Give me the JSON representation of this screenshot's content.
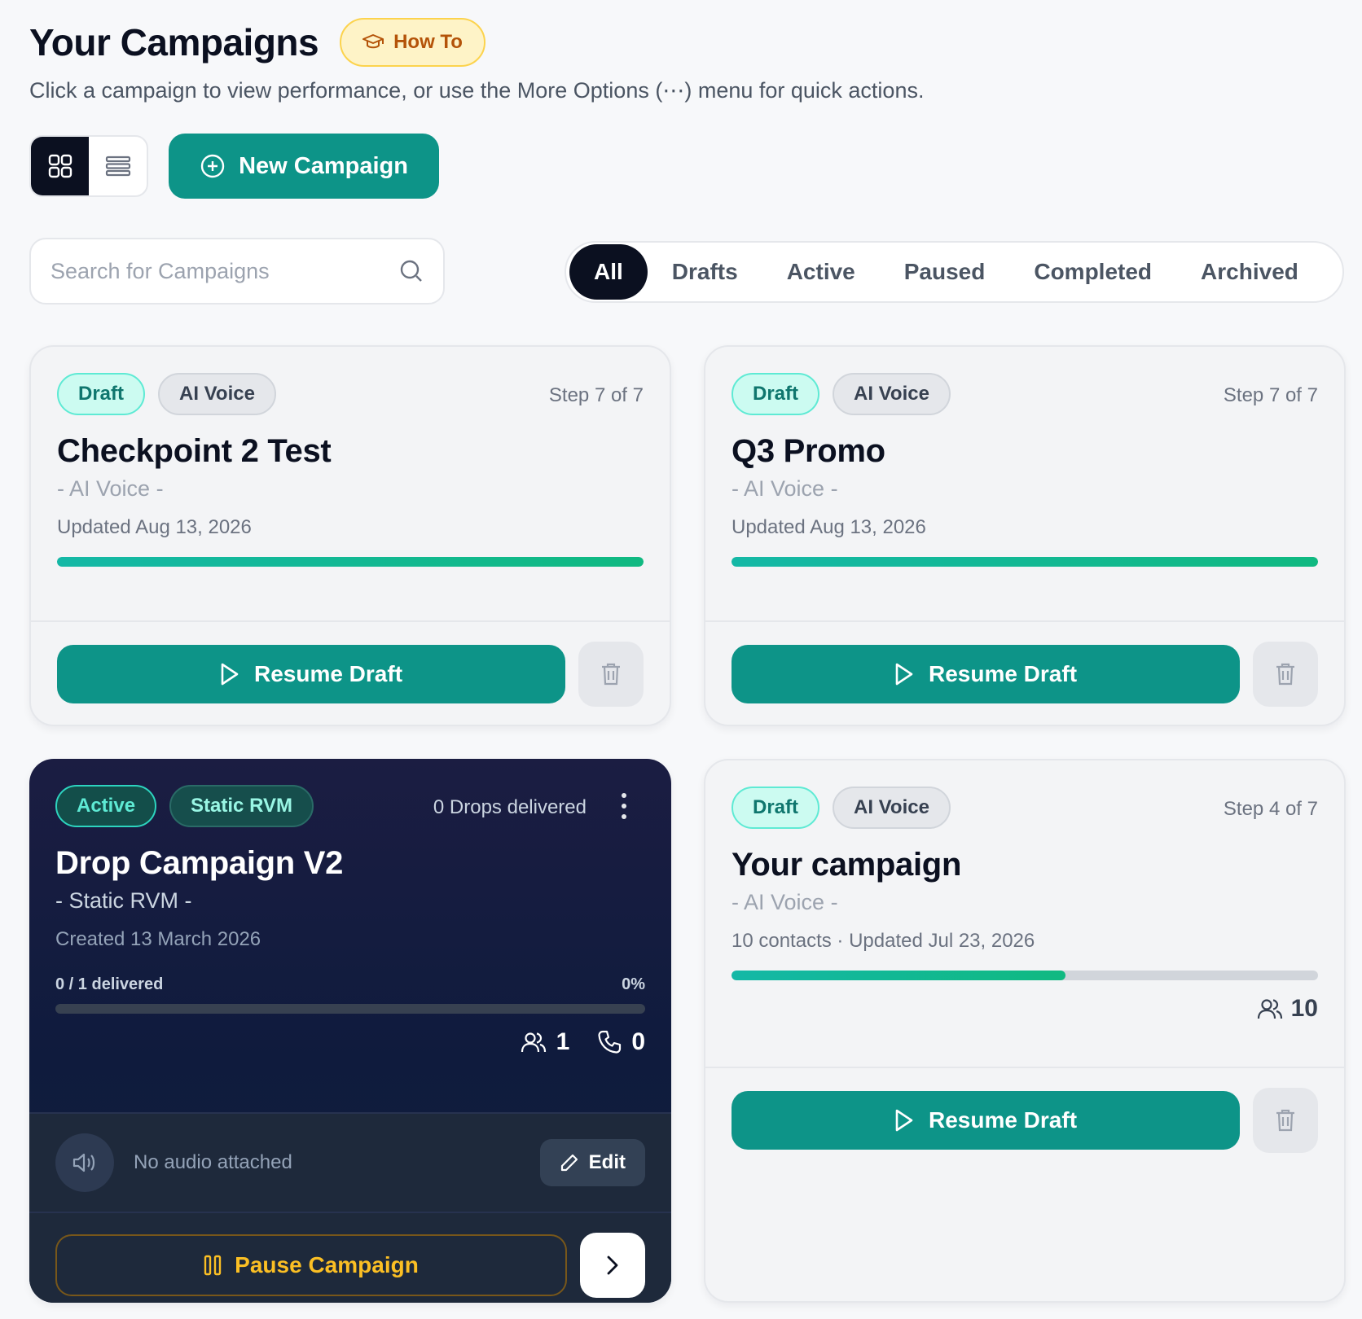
{
  "header": {
    "title": "Your Campaigns",
    "how_to_label": "How To",
    "subtitle": "Click a campaign to view performance, or use the More Options (⋯) menu for quick actions."
  },
  "toolbar": {
    "new_campaign_label": "New Campaign",
    "view_mode": "grid"
  },
  "search": {
    "placeholder": "Search for Campaigns",
    "value": ""
  },
  "filters": {
    "tabs": [
      "All",
      "Drafts",
      "Active",
      "Paused",
      "Completed",
      "Archived"
    ],
    "selected": "All"
  },
  "campaigns": [
    {
      "status": "Draft",
      "type": "AI Voice",
      "step": "Step 7 of 7",
      "name": "Checkpoint 2 Test",
      "subtitle": "- AI Voice -",
      "meta": "Updated Aug 13, 2026",
      "progress": 1.0,
      "action_label": "Resume Draft"
    },
    {
      "status": "Draft",
      "type": "AI Voice",
      "step": "Step 7 of 7",
      "name": "Q3 Promo",
      "subtitle": "- AI Voice -",
      "meta": "Updated Aug 13, 2026",
      "progress": 1.0,
      "action_label": "Resume Draft"
    },
    {
      "status": "Active",
      "type": "Static RVM",
      "drops": "0 Drops delivered",
      "name": "Drop Campaign V2",
      "subtitle": "- Static RVM -",
      "meta": "Created 13 March 2026",
      "delivered_label": "0 / 1 delivered",
      "delivered_pct": "0%",
      "progress": 0.0,
      "contacts": "1",
      "calls": "0",
      "audio_text": "No audio attached",
      "edit_label": "Edit",
      "action_label": "Pause Campaign"
    },
    {
      "status": "Draft",
      "type": "AI Voice",
      "step": "Step 4 of 7",
      "name": "Your campaign",
      "subtitle": "- AI Voice -",
      "meta": "10 contacts · Updated Jul 23, 2026",
      "progress": 0.57,
      "contacts": "10",
      "action_label": "Resume Draft"
    }
  ],
  "colors": {
    "accent": "#0d9488",
    "dark_card": "#0f1b3d",
    "warning": "#fbbf24"
  }
}
